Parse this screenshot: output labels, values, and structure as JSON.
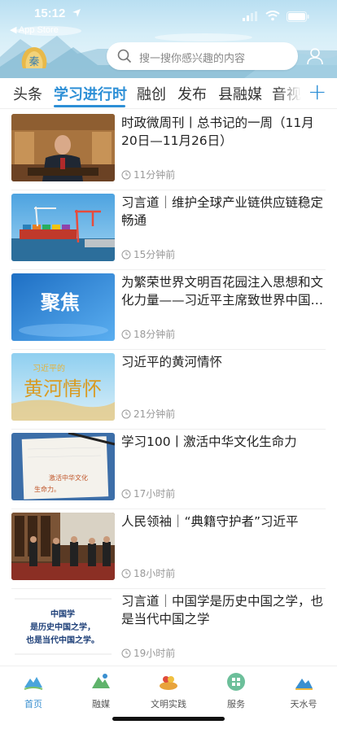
{
  "status_bar": {
    "time": "15:12",
    "back_label": "◀ App Store"
  },
  "header": {
    "search_placeholder": "搜一搜你感兴趣的内容",
    "logo_text": "秦"
  },
  "tabs": [
    {
      "label": "头条"
    },
    {
      "label": "学习进行时"
    },
    {
      "label": "融创"
    },
    {
      "label": "发布"
    },
    {
      "label": "县融媒"
    },
    {
      "label": "音视"
    }
  ],
  "active_tab": "学习进行时",
  "add_tab_label": "+",
  "articles": [
    {
      "title": "时政微周刊丨总书记的一周（11月20日—11月26日）",
      "time": "11分钟前"
    },
    {
      "title": "习言道｜维护全球产业链供应链稳定畅通",
      "time": "15分钟前"
    },
    {
      "title": "为繁荣世界文明百花园注入思想和文化力量——习近平主席致世界中国学大会贺信",
      "time": "18分钟前",
      "thumb_text": "聚焦"
    },
    {
      "title": "习近平的黄河情怀",
      "time": "21分钟前",
      "thumb_text_top": "习近平的",
      "thumb_text_main": "黄河情怀"
    },
    {
      "title": "学习100丨激活中华文化生命力",
      "time": "17小时前",
      "thumb_text_lines": [
        "激活中华文化",
        "生命力。"
      ]
    },
    {
      "title": "人民领袖｜“典籍守护者”习近平",
      "time": "18小时前"
    },
    {
      "title": "习言道｜中国学是历史中国之学，也是当代中国之学",
      "time": "19小时前",
      "thumb_text_lines": [
        "中国学",
        "是历史中国之学，",
        "也是当代中国之学。"
      ]
    }
  ],
  "bottom_nav": [
    {
      "label": "首页"
    },
    {
      "label": "融媒"
    },
    {
      "label": "文明实践"
    },
    {
      "label": "服务"
    },
    {
      "label": "天水号"
    }
  ],
  "colors": {
    "accent": "#2d8fd6",
    "time_gray": "#999999"
  }
}
